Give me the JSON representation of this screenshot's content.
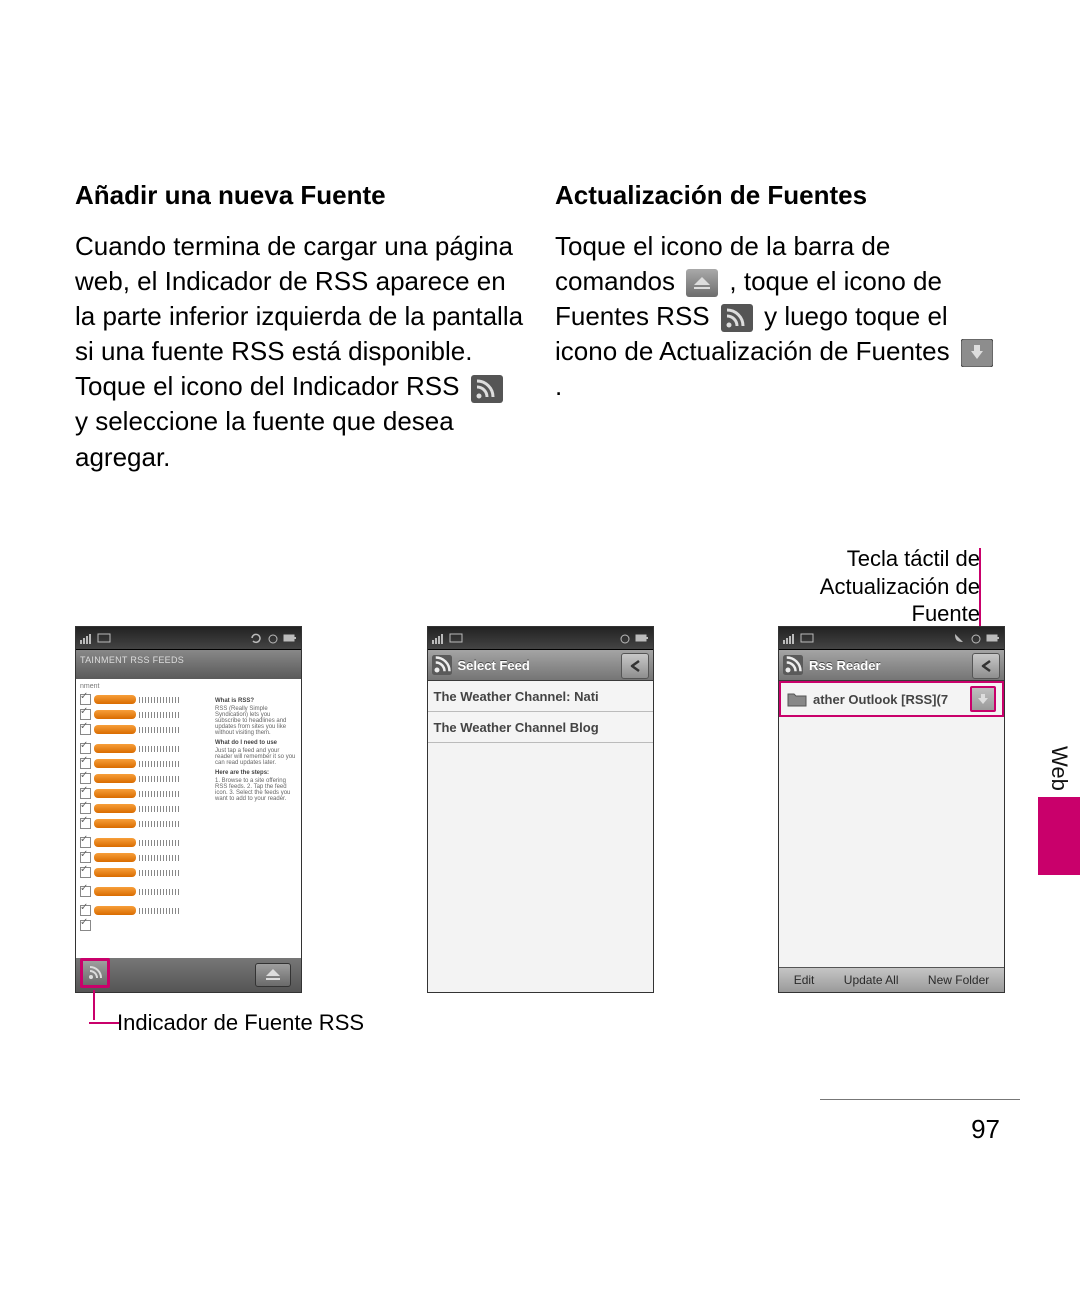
{
  "headings": {
    "left": "Añadir una nueva Fuente",
    "right": "Actualización de Fuentes"
  },
  "paragraphs": {
    "left_before_icon": "Cuando termina de cargar una página web, el Indicador de RSS aparece en la parte inferior izquierda de la pantalla si una fuente RSS está disponible. Toque el icono del Indicador RSS ",
    "left_after_icon": " y seleccione la fuente que desea agregar.",
    "right_p1_pre": "Toque el icono de la barra de comandos ",
    "right_p1_mid": " , toque el icono de Fuentes RSS ",
    "right_p1_mid2": " y luego toque el icono de Actualización de Fuentes ",
    "right_p1_end": " ."
  },
  "callouts": {
    "refresh": "Tecla táctil de Actualización de Fuente",
    "rss_indicator": "Indicador de Fuente RSS"
  },
  "screenshot1": {
    "browser_header": "TAINMENT RSS FEEDS",
    "tiny": "nment",
    "help": {
      "h1": "What is RSS?",
      "b1": "RSS (Really Simple Syndication) lets you subscribe to headlines and updates from sites you like without visiting them.",
      "h2": "What do I need to use",
      "b2": "Just tap a feed and your reader will remember it so you can read updates later.",
      "h3": "Here are the steps:",
      "b3": "1. Browse to a site offering RSS feeds. 2. Tap the feed icon. 3. Select the feeds you want to add to your reader."
    }
  },
  "screenshot2": {
    "title": "Select Feed",
    "row1": "The Weather Channel: Nati",
    "row2": "The Weather Channel Blog"
  },
  "screenshot3": {
    "title": "Rss Reader",
    "row1": "ather Outlook [RSS](7",
    "soft": {
      "left": "Edit",
      "mid": "Update All",
      "right": "New Folder"
    }
  },
  "side_tab": "Web",
  "page_number": "97"
}
